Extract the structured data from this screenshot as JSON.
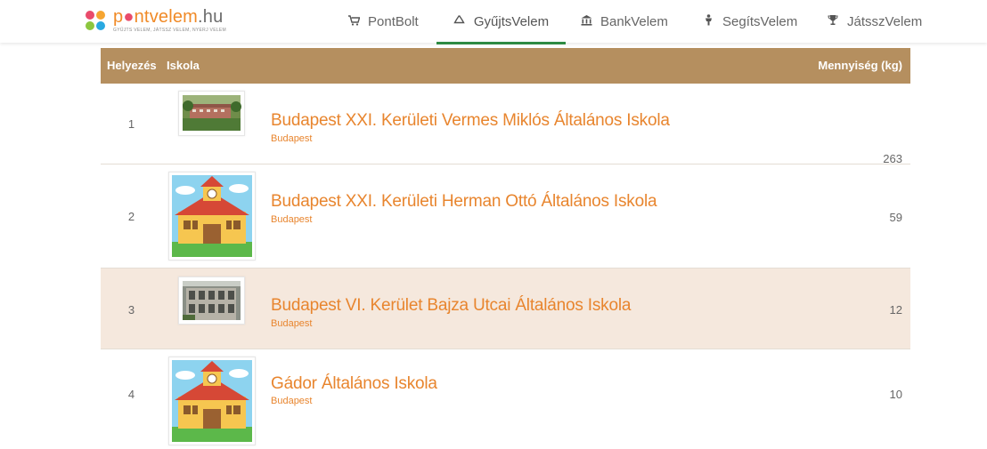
{
  "header": {
    "logo": {
      "brand_pre": "p",
      "brand_accent": "●",
      "brand_main": "ntvelem",
      "brand_suffix": ".hu",
      "tagline": "GYŰJTS VELEM, JÁTSSZ VELEM, NYERJ VELEM"
    },
    "nav": [
      {
        "label": "PontBolt",
        "icon": "cart-icon"
      },
      {
        "label": "GyűjtsVelem",
        "icon": "recycle-icon",
        "active": true
      },
      {
        "label": "BankVelem",
        "icon": "bank-icon"
      },
      {
        "label": "SegítsVelem",
        "icon": "person-icon"
      },
      {
        "label": "JátsszVelem",
        "icon": "trophy-icon"
      }
    ]
  },
  "colors": {
    "accent": "#e8852e",
    "header_bg": "#b58f5f",
    "active_underline": "#2e8b43",
    "alt_row": "#f5e8dd"
  },
  "table": {
    "columns": {
      "rank": "Helyezés",
      "school": "Iskola",
      "amount": "Mennyiség (kg)"
    },
    "rows": [
      {
        "rank": "1",
        "name": "Budapest XXI. Kerületi Vermes Miklós Általános Iskola",
        "city": "Budapest",
        "amount": "263",
        "thumb": "photo"
      },
      {
        "rank": "2",
        "name": "Budapest XXI. Kerületi Herman Ottó Általános Iskola",
        "city": "Budapest",
        "amount": "59",
        "thumb": "illustration"
      },
      {
        "rank": "3",
        "name": "Budapest VI. Kerület Bajza Utcai Általános Iskola",
        "city": "Budapest",
        "amount": "12",
        "thumb": "photo"
      },
      {
        "rank": "4",
        "name": "Gádor Általános Iskola",
        "city": "Budapest",
        "amount": "10",
        "thumb": "illustration"
      }
    ]
  }
}
